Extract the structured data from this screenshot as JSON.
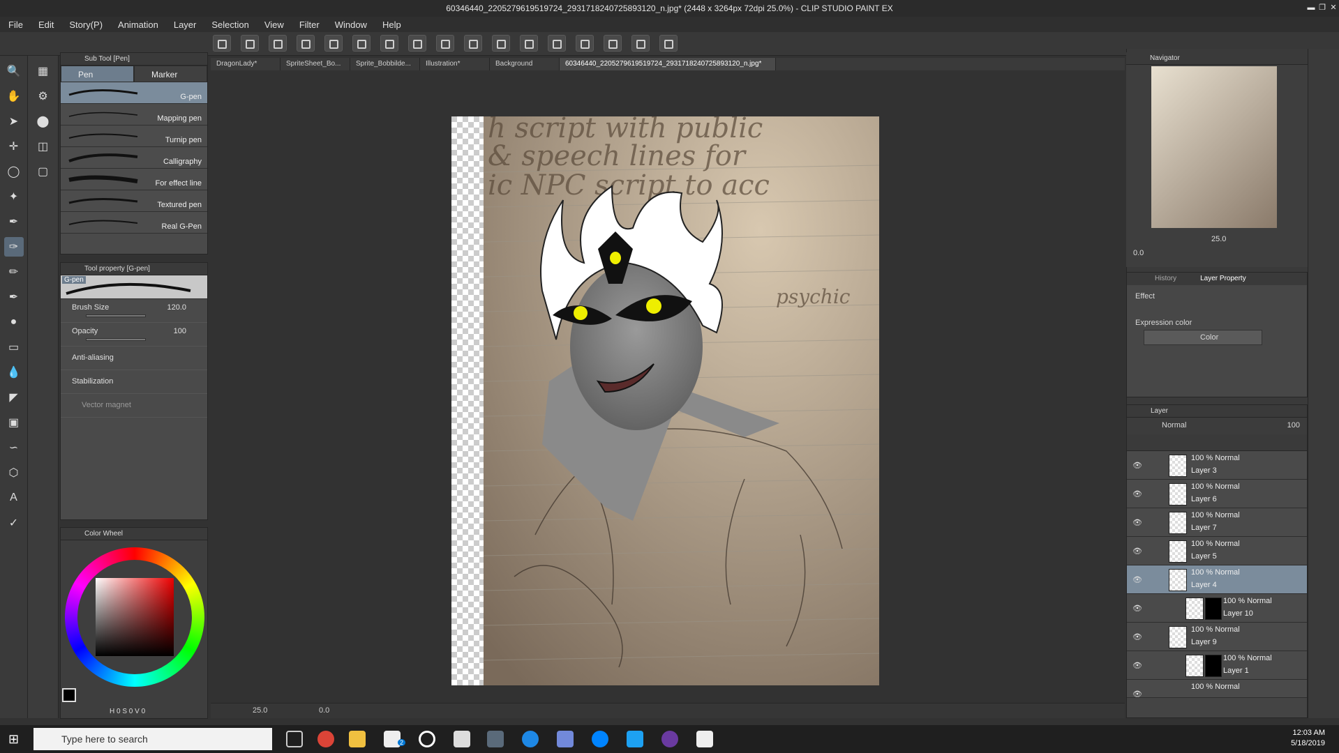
{
  "window": {
    "title": "60346440_2205279619519724_2931718240725893120_n.jpg* (2448 x 3264px 72dpi 25.0%) - CLIP STUDIO PAINT EX"
  },
  "menu": [
    "File",
    "Edit",
    "Story(P)",
    "Animation",
    "Layer",
    "Selection",
    "View",
    "Filter",
    "Window",
    "Help"
  ],
  "doc_tabs": [
    "DragonLady*",
    "SpriteSheet_Bo...",
    "Sprite_Bobbilde...",
    "Illustration*",
    "Background",
    "60346440_2205279619519724_2931718240725893120_n.jpg*"
  ],
  "subtool": {
    "header": "Sub Tool [Pen]",
    "tabs": [
      "Pen",
      "Marker"
    ],
    "brushes": [
      "G-pen",
      "Mapping pen",
      "Turnip pen",
      "Calligraphy",
      "For effect line",
      "Textured pen",
      "Real G-Pen"
    ]
  },
  "tool_property": {
    "header": "Tool property [G-pen]",
    "preset": "G-pen",
    "brush_size_label": "Brush Size",
    "brush_size": "120.0",
    "opacity_label": "Opacity",
    "opacity": "100",
    "antialias_label": "Anti-aliasing",
    "stabilization_label": "Stabilization",
    "vector_magnet_label": "Vector magnet"
  },
  "color_wheel": {
    "header": "Color Wheel",
    "readout": "H 0 S 0 V 0"
  },
  "canvas": {
    "paper_text_1": "h script with public",
    "paper_text_2": "& speech lines for",
    "paper_text_3": "ic NPC script to acc",
    "paper_text_4": "psychic"
  },
  "statusbar": {
    "zoom": "25.0",
    "rotation": "0.0"
  },
  "navigator": {
    "header": "Navigator",
    "zoom": "25.0",
    "rotation": "0.0"
  },
  "layer_property": {
    "tabs": [
      "History",
      "Layer Property"
    ],
    "effect_label": "Effect",
    "expression_color_label": "Expression color",
    "expression_color": "Color"
  },
  "layer_panel": {
    "header": "Layer",
    "blend_mode": "Normal",
    "opacity": "100",
    "layers": [
      {
        "mode": "100 % Normal",
        "name": "Layer 3"
      },
      {
        "mode": "100 % Normal",
        "name": "Layer 6"
      },
      {
        "mode": "100 % Normal",
        "name": "Layer 7"
      },
      {
        "mode": "100 % Normal",
        "name": "Layer 5"
      },
      {
        "mode": "100 % Normal",
        "name": "Layer 4"
      },
      {
        "mode": "100 % Normal",
        "name": "Layer 10"
      },
      {
        "mode": "100 % Normal",
        "name": "Layer 9"
      },
      {
        "mode": "100 % Normal",
        "name": "Layer 1"
      },
      {
        "mode": "100 % Normal",
        "name": ""
      }
    ]
  },
  "taskbar": {
    "search_placeholder": "Type here to search",
    "time": "12:03 AM",
    "date": "5/18/2019",
    "mail_badge": "2"
  }
}
